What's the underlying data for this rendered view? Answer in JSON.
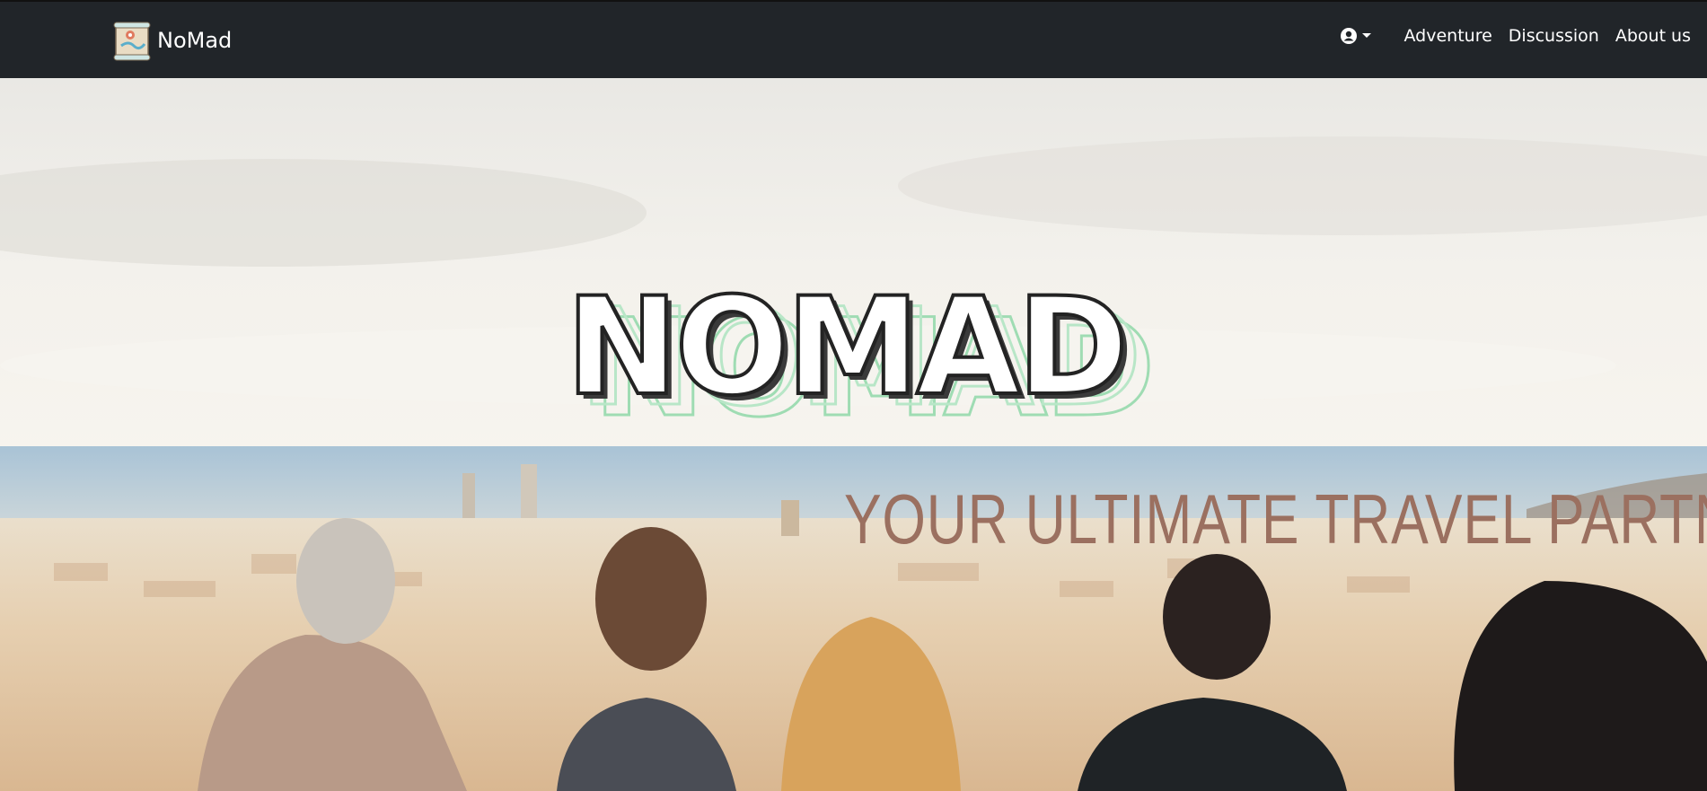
{
  "navbar": {
    "brand": "NoMad",
    "links": [
      {
        "label": "Adventure"
      },
      {
        "label": "Discussion"
      },
      {
        "label": "About us"
      }
    ]
  },
  "hero": {
    "title": "NOMAD",
    "tagline": "YOUR ULTIMATE TRAVEL PARTNER"
  },
  "icons": [
    "map-scroll-logo-icon",
    "user-circle-icon",
    "caret-down-icon"
  ],
  "colors": {
    "navbar": "#212529",
    "tagline": "#9b7060",
    "title_shadow": "#9fdcb3"
  }
}
